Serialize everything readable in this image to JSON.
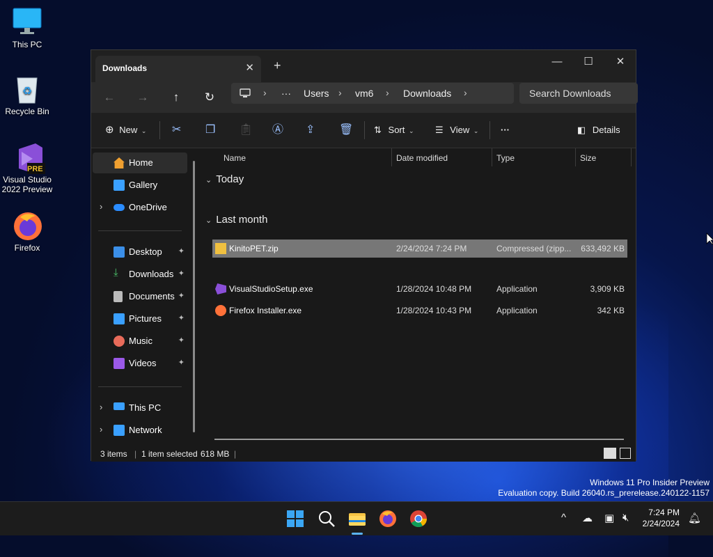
{
  "desktop": {
    "icons": [
      {
        "label": "This PC"
      },
      {
        "label": "Recycle Bin"
      },
      {
        "label": "Visual Studio 2022 Preview"
      },
      {
        "label": "Firefox"
      }
    ],
    "vs_badge": "PRE",
    "watermark_line1": "Windows 11 Pro Insider Preview",
    "watermark_line2": "Evaluation copy. Build 26040.rs_prerelease.240122-1157"
  },
  "window": {
    "tab_title": "Downloads",
    "tab_close": "✕",
    "tab_add": "+",
    "controls": {
      "minimize": "—",
      "maximize": "☐",
      "close": "✕"
    },
    "nav": {
      "back": "←",
      "forward": "→",
      "up": "↑",
      "refresh": "↻"
    },
    "breadcrumb": {
      "ellipsis": "···",
      "items": [
        "Users",
        "vm6",
        "Downloads"
      ],
      "sep": "›"
    },
    "search_placeholder": "Search Downloads",
    "toolbar": {
      "new_label": "New",
      "sort_label": "Sort",
      "view_label": "View",
      "more_label": "···",
      "details_label": "Details"
    },
    "sidebar": {
      "items": [
        {
          "label": "Home",
          "icon": "home-icon",
          "color": "#f0a030"
        },
        {
          "label": "Gallery",
          "icon": "gallery-icon",
          "color": "#3aa0ff"
        },
        {
          "label": "OneDrive",
          "icon": "cloud-icon",
          "color": "#2a8cff"
        },
        {
          "label": "Desktop",
          "icon": "desktop-icon",
          "color": "#3b8fe8"
        },
        {
          "label": "Downloads",
          "icon": "download-icon",
          "color": "#4cc36b"
        },
        {
          "label": "Documents",
          "icon": "document-icon",
          "color": "#bbbbbb"
        },
        {
          "label": "Pictures",
          "icon": "pictures-icon",
          "color": "#3aa0ff"
        },
        {
          "label": "Music",
          "icon": "music-icon",
          "color": "#e86b5a"
        },
        {
          "label": "Videos",
          "icon": "videos-icon",
          "color": "#9b59e8"
        },
        {
          "label": "This PC",
          "icon": "pc-icon",
          "color": "#3aa0ff"
        },
        {
          "label": "Network",
          "icon": "network-icon",
          "color": "#3aa0ff"
        }
      ],
      "pin": "📌"
    },
    "columns": [
      "Name",
      "Date modified",
      "Type",
      "Size"
    ],
    "groups": [
      {
        "title": "Today",
        "rows": [
          {
            "name": "KinitoPET.zip",
            "date": "2/24/2024 7:24 PM",
            "type": "Compressed (zipp...",
            "size": "633,492 KB",
            "selected": true
          }
        ]
      },
      {
        "title": "Last month",
        "rows": [
          {
            "name": "VisualStudioSetup.exe",
            "date": "1/28/2024 10:48 PM",
            "type": "Application",
            "size": "3,909 KB",
            "selected": false
          },
          {
            "name": "Firefox Installer.exe",
            "date": "1/28/2024 10:43 PM",
            "type": "Application",
            "size": "342 KB",
            "selected": false
          }
        ]
      }
    ],
    "status": {
      "items": "3 items",
      "selected": "1 item selected",
      "size": "618 MB"
    }
  },
  "taskbar": {
    "time": "7:24 PM",
    "date": "2/24/2024",
    "tray_chevron": "^"
  }
}
